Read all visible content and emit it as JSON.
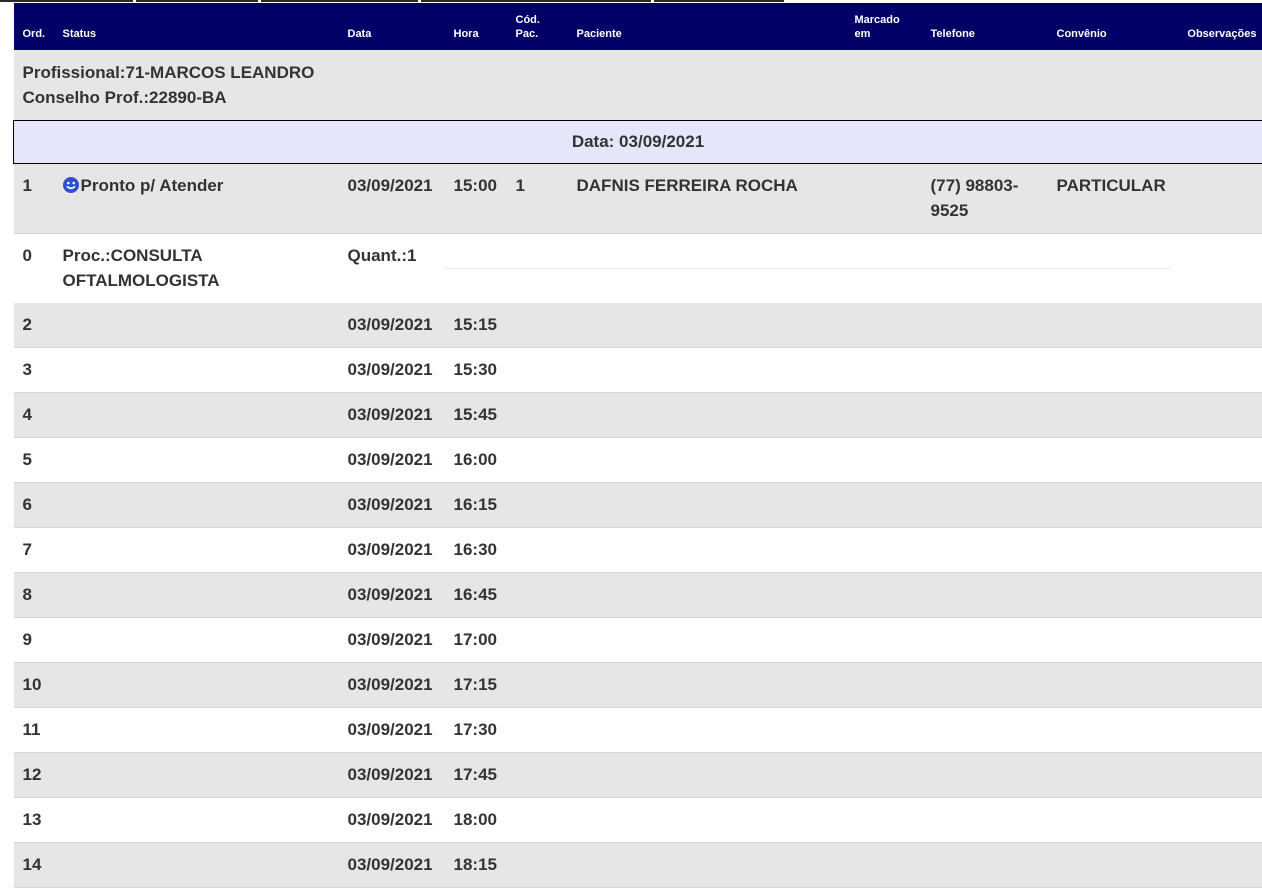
{
  "header": {
    "ord": "Ord.",
    "status": "Status",
    "data": "Data",
    "hora": "Hora",
    "cod_pac_1": "Cód.",
    "cod_pac_2": "Pac.",
    "paciente": "Paciente",
    "marcado_1": "Marcado",
    "marcado_2": "em",
    "telefone": "Telefone",
    "convenio": "Convênio",
    "observacoes": "Observações"
  },
  "professional": {
    "name_line": "Profissional:71-MARCOS LEANDRO",
    "council_line": "Conselho Prof.:22890-BA"
  },
  "date_band": "Data: 03/09/2021",
  "booked": {
    "ord": "1",
    "status_icon": "smiley-icon",
    "status": "Pronto p/ Atender",
    "data": "03/09/2021",
    "hora": "15:00",
    "cod_pac": "1",
    "paciente": "DAFNIS FERREIRA ROCHA",
    "telefone_1": "(77) 98803-",
    "telefone_2": "9525",
    "convenio": "PARTICULAR"
  },
  "procedure": {
    "ord": "0",
    "proc_1": "Proc.:CONSULTA",
    "proc_2": "OFTALMOLOGISTA",
    "quant": "Quant.:1"
  },
  "slots": [
    {
      "ord": "2",
      "data": "03/09/2021",
      "hora": "15:15"
    },
    {
      "ord": "3",
      "data": "03/09/2021",
      "hora": "15:30"
    },
    {
      "ord": "4",
      "data": "03/09/2021",
      "hora": "15:45"
    },
    {
      "ord": "5",
      "data": "03/09/2021",
      "hora": "16:00"
    },
    {
      "ord": "6",
      "data": "03/09/2021",
      "hora": "16:15"
    },
    {
      "ord": "7",
      "data": "03/09/2021",
      "hora": "16:30"
    },
    {
      "ord": "8",
      "data": "03/09/2021",
      "hora": "16:45"
    },
    {
      "ord": "9",
      "data": "03/09/2021",
      "hora": "17:00"
    },
    {
      "ord": "10",
      "data": "03/09/2021",
      "hora": "17:15"
    },
    {
      "ord": "11",
      "data": "03/09/2021",
      "hora": "17:30"
    },
    {
      "ord": "12",
      "data": "03/09/2021",
      "hora": "17:45"
    },
    {
      "ord": "13",
      "data": "03/09/2021",
      "hora": "18:00"
    },
    {
      "ord": "14",
      "data": "03/09/2021",
      "hora": "18:15"
    }
  ],
  "colors": {
    "header_bg": "#000066",
    "row_gray": "#e6e6e6",
    "date_band_bg": "#e6e6fa",
    "status_icon": "#2f4fd0"
  }
}
